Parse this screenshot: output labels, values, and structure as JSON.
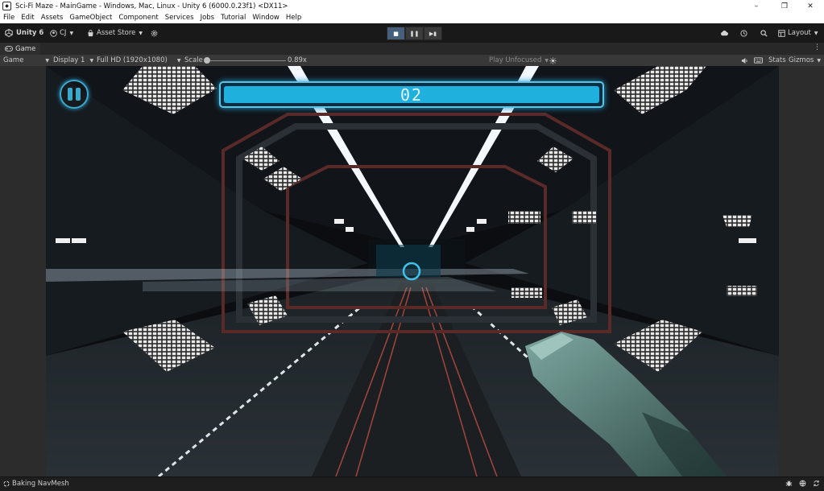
{
  "window": {
    "title": "Sci-Fi Maze - MainGame - Windows, Mac, Linux - Unity 6 (6000.0.23f1) <DX11>",
    "controls": {
      "minimize": "–",
      "maximize": "❐",
      "close": "✕"
    }
  },
  "menu": [
    "File",
    "Edit",
    "Assets",
    "GameObject",
    "Component",
    "Services",
    "Jobs",
    "Tutorial",
    "Window",
    "Help"
  ],
  "toolbar": {
    "unity_label": "Unity 6",
    "account_label": "CJ",
    "asset_store_label": "Asset Store",
    "layout_label": "Layout",
    "icons": [
      "settings-icon",
      "cloud-icon",
      "history-icon",
      "search-icon"
    ],
    "play_controls": [
      "play",
      "pause",
      "step"
    ]
  },
  "game_tab": {
    "label": "Game"
  },
  "game_toolbar": {
    "view_mode": "Game",
    "display": "Display 1",
    "resolution": "Full HD (1920x1080)",
    "scale_label": "Scale",
    "scale_value": "0.89x",
    "scale_fraction": 0.0,
    "play_focus": "Play Unfocused",
    "stats_label": "Stats",
    "gizmos_label": "Gizmos"
  },
  "hud": {
    "counter": "02",
    "accent": "#1fb0de",
    "pause_icon": "pause-icon"
  },
  "status": {
    "message": "Baking NavMesh"
  }
}
